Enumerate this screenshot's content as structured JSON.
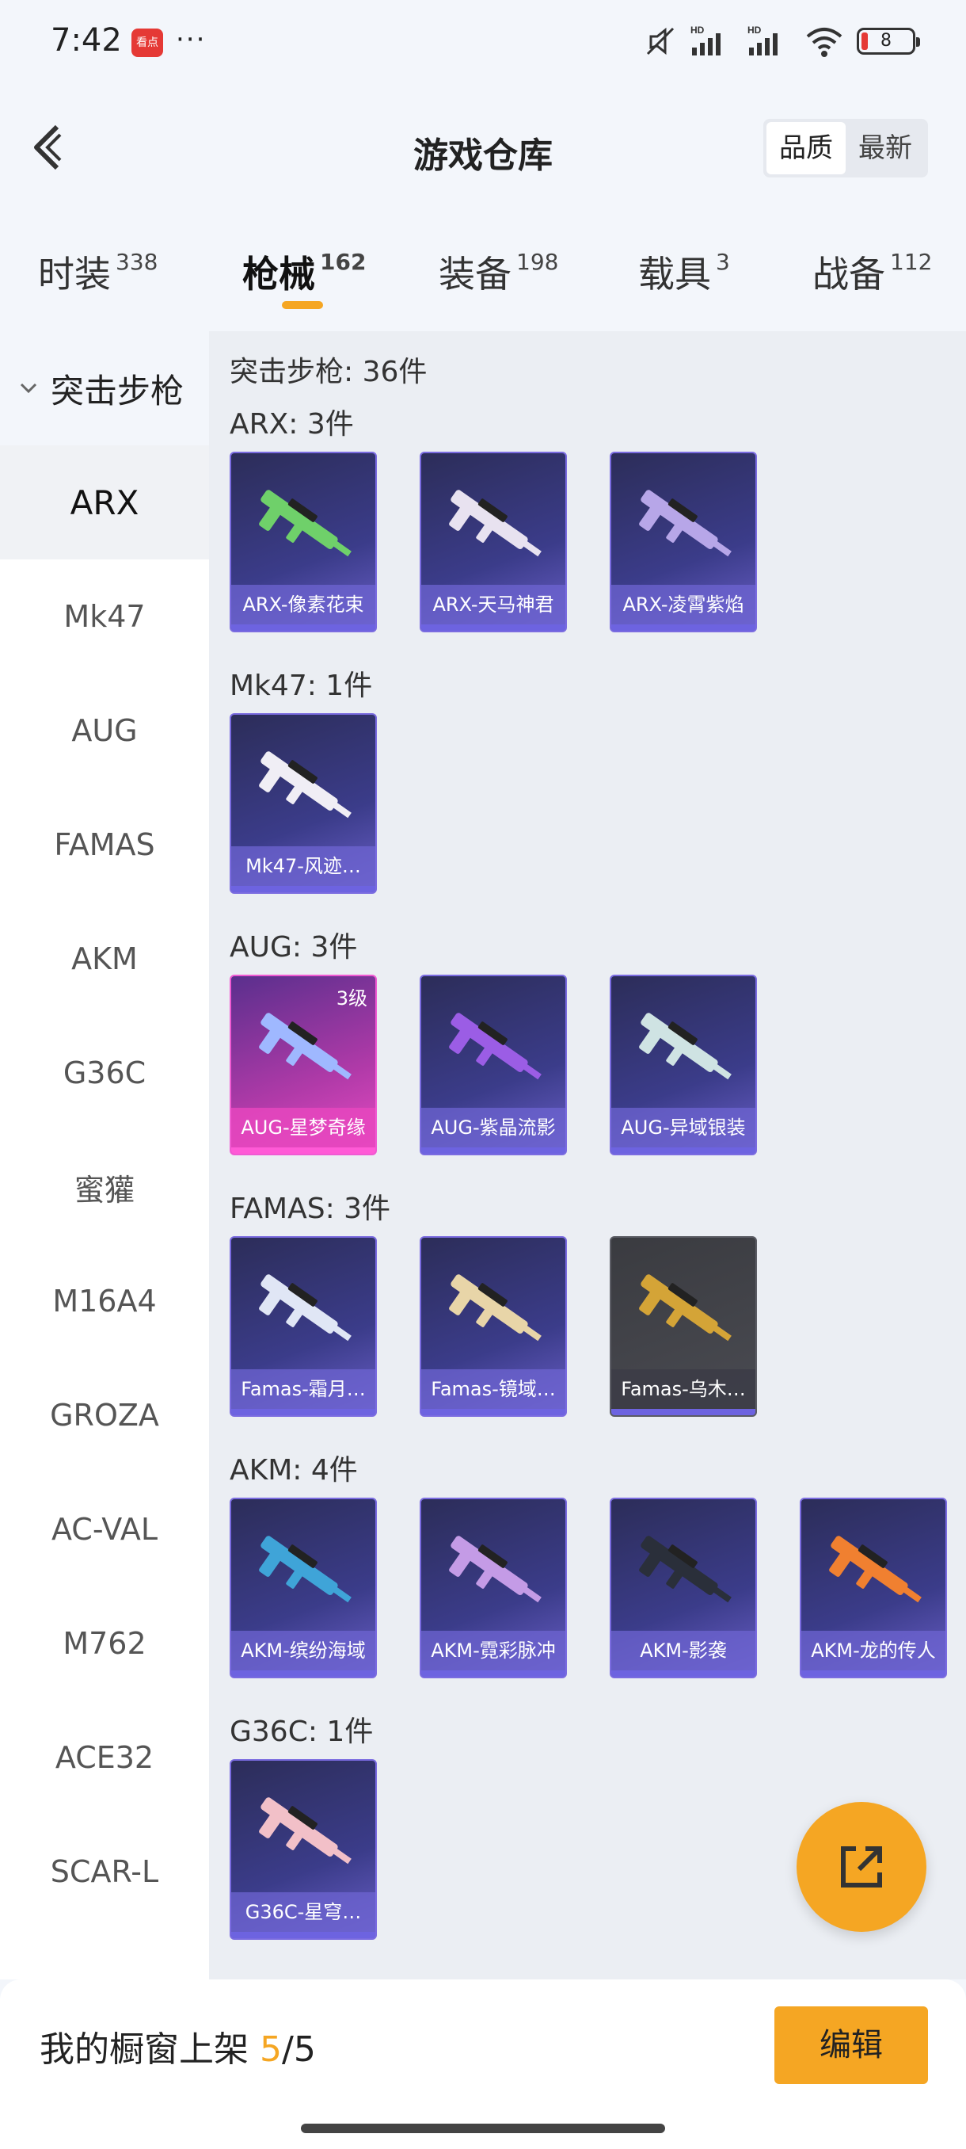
{
  "status": {
    "time": "7:42",
    "app_badge": "看点",
    "more": "···",
    "battery": "8"
  },
  "header": {
    "title": "游戏仓库",
    "sort_quality": "品质",
    "sort_newest": "最新"
  },
  "tabs": [
    {
      "label": "时装",
      "count": "338"
    },
    {
      "label": "枪械",
      "count": "162"
    },
    {
      "label": "装备",
      "count": "198"
    },
    {
      "label": "载具",
      "count": "3"
    },
    {
      "label": "战备",
      "count": "112"
    }
  ],
  "sidebar": {
    "group": "突击步枪",
    "items": [
      "ARX",
      "Mk47",
      "AUG",
      "FAMAS",
      "AKM",
      "G36C",
      "蜜獾",
      "M16A4",
      "GROZA",
      "AC-VAL",
      "M762",
      "ACE32",
      "SCAR-L"
    ]
  },
  "main": {
    "summary": "突击步枪: 36件",
    "sections": [
      {
        "title": "ARX: 3件",
        "items": [
          {
            "label": "ARX-像素花束",
            "color": "#6fd06a"
          },
          {
            "label": "ARX-天马神君",
            "color": "#e8e2f0"
          },
          {
            "label": "ARX-凌霄紫焰",
            "color": "#b7a6e8"
          }
        ]
      },
      {
        "title": "Mk47: 1件",
        "items": [
          {
            "label": "Mk47-风迹…",
            "color": "#f0eef5"
          }
        ]
      },
      {
        "title": "AUG: 3件",
        "items": [
          {
            "label": "AUG-星梦奇缘",
            "color": "#9fb8ff",
            "tier": "3级"
          },
          {
            "label": "AUG-紫晶流影",
            "color": "#9b5de5"
          },
          {
            "label": "AUG-异域银装",
            "color": "#cfe3e3"
          }
        ]
      },
      {
        "title": "FAMAS: 3件",
        "items": [
          {
            "label": "Famas-霜月…",
            "color": "#e0e6f5"
          },
          {
            "label": "Famas-镜域…",
            "color": "#e8d5a8"
          },
          {
            "label": "Famas-乌木…",
            "color": "#d4a437"
          }
        ]
      },
      {
        "title": "AKM: 4件",
        "items": [
          {
            "label": "AKM-缤纷海域",
            "color": "#3fa4d8"
          },
          {
            "label": "AKM-霓彩脉冲",
            "color": "#c49be6"
          },
          {
            "label": "AKM-影袭",
            "color": "#2a2f3a"
          },
          {
            "label": "AKM-龙的传人",
            "color": "#f08030"
          }
        ]
      },
      {
        "title": "G36C: 1件",
        "items": [
          {
            "label": "G36C-星穹…",
            "color": "#f2c0c8"
          }
        ]
      }
    ]
  },
  "bottom": {
    "prefix": "我的橱窗上架 ",
    "current": "5",
    "sep": "/",
    "total": "5",
    "edit": "编辑"
  }
}
